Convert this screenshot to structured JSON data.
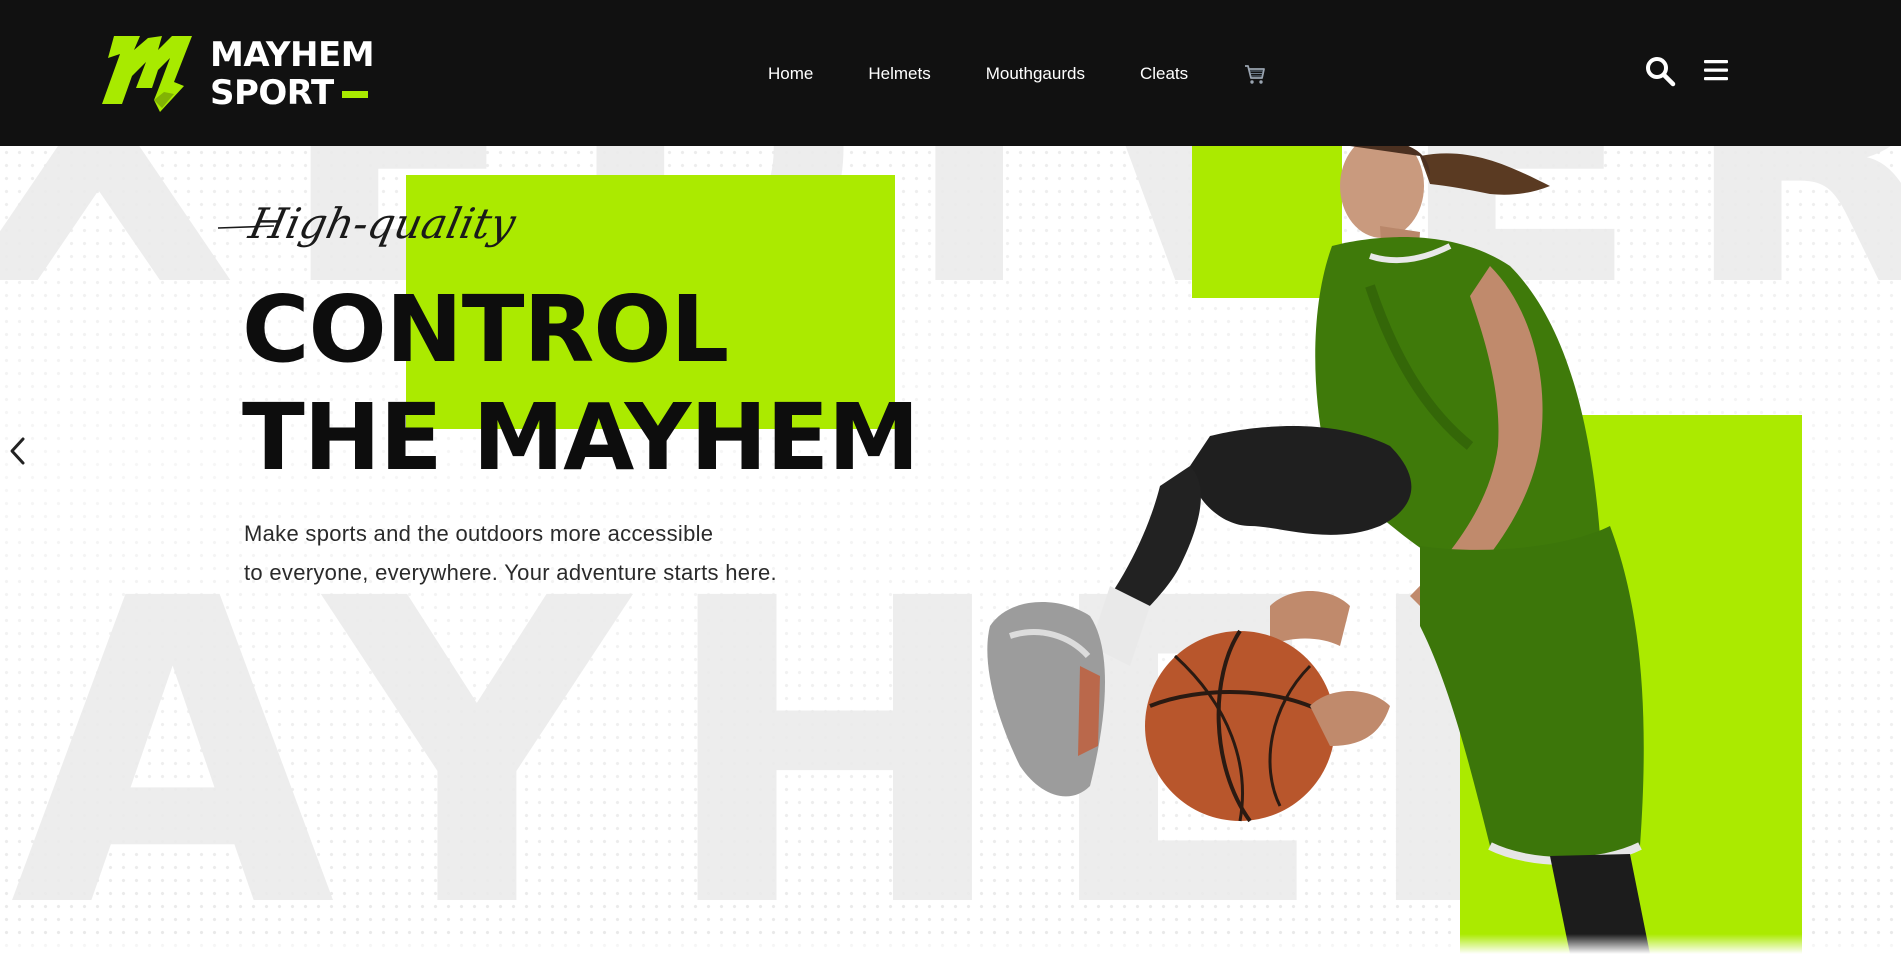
{
  "header": {
    "logo": {
      "line1": "MAYHEM",
      "line2": "SPORT",
      "icon": "mayhem-logo-mark"
    },
    "nav": [
      {
        "label": "Home"
      },
      {
        "label": "Helmets"
      },
      {
        "label": "Mouthgaurds"
      },
      {
        "label": "Cleats"
      }
    ],
    "cart_icon": "shopping-cart-icon",
    "search_icon": "search-icon",
    "menu_icon": "hamburger-menu-icon"
  },
  "hero": {
    "eyebrow": "High-quality",
    "title_line1": "CONTROL",
    "title_line2": "THE MAYHEM",
    "subtitle_line1": "Make sports and the outdoors more accessible",
    "subtitle_line2": "to everyone, everywhere. Your adventure starts here.",
    "background_word_top": "XEDIVER",
    "background_word_bottom": "AYHEM",
    "prev_icon": "chevron-left-icon",
    "image": "basketball-player-photo"
  },
  "colors": {
    "header_bg": "#111111",
    "accent": "#abea00",
    "text_dark": "#0d0d0d",
    "text_body": "#2a2a2a"
  }
}
